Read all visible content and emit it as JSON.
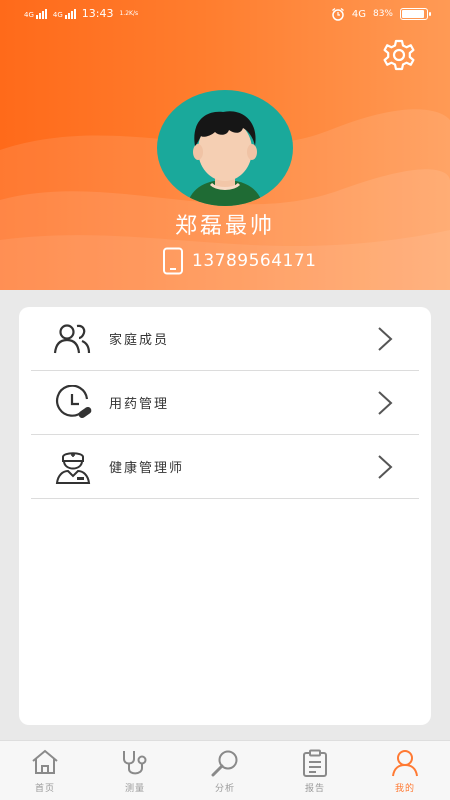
{
  "status_bar": {
    "sim1": "4G",
    "sim2": "4G",
    "time": "13:43",
    "net_speed": "1.2K/s",
    "network": "4G",
    "battery_percent": "83%",
    "battery_level": 0.83
  },
  "profile": {
    "name": "郑磊最帅",
    "phone": "13789564171"
  },
  "menu": {
    "items": [
      {
        "label": "家庭成员",
        "icon": "family-members-icon"
      },
      {
        "label": "用药管理",
        "icon": "medication-clock-icon"
      },
      {
        "label": "健康管理师",
        "icon": "health-manager-icon"
      }
    ]
  },
  "nav": {
    "items": [
      {
        "label": "首页",
        "icon": "home-icon"
      },
      {
        "label": "测量",
        "icon": "stethoscope-icon"
      },
      {
        "label": "分析",
        "icon": "search-icon"
      },
      {
        "label": "报告",
        "icon": "clipboard-icon"
      },
      {
        "label": "我的",
        "icon": "profile-icon"
      }
    ],
    "active_index": 4
  },
  "colors": {
    "header_primary": "#ff6a1a",
    "accent": "#ff7a33",
    "avatar_bg": "#1aa99b"
  }
}
